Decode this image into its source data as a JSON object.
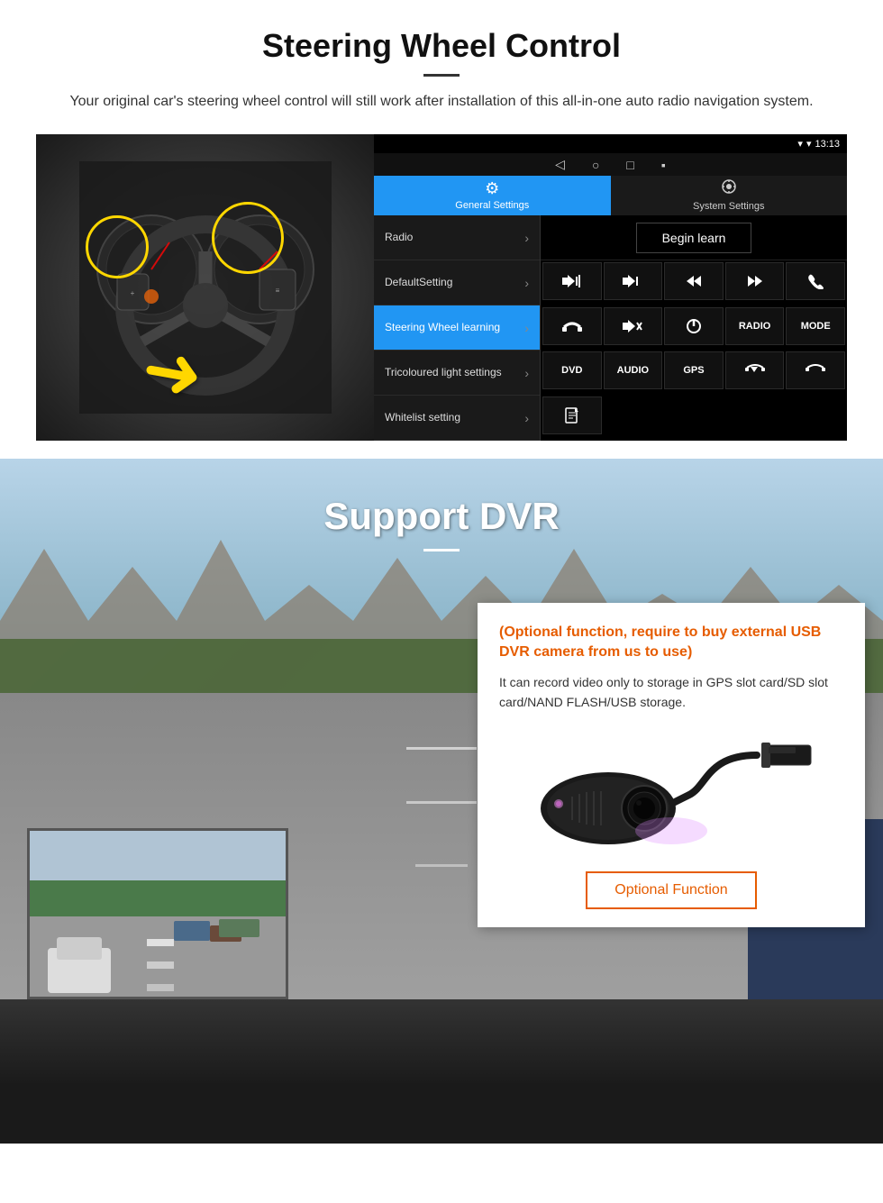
{
  "steering_section": {
    "title": "Steering Wheel Control",
    "description": "Your original car's steering wheel control will still work after installation of this all-in-one auto radio navigation system.",
    "statusbar": {
      "signal": "▾",
      "wifi": "▾",
      "time": "13:13"
    },
    "nav_buttons": [
      "◁",
      "○",
      "□",
      "▪"
    ],
    "tabs": [
      {
        "label": "General Settings",
        "active": true,
        "icon": "⚙"
      },
      {
        "label": "System Settings",
        "active": false,
        "icon": "🔧"
      }
    ],
    "menu_items": [
      {
        "label": "Radio",
        "active": false
      },
      {
        "label": "DefaultSetting",
        "active": false
      },
      {
        "label": "Steering Wheel learning",
        "active": true
      },
      {
        "label": "Tricoloured light settings",
        "active": false
      },
      {
        "label": "Whitelist setting",
        "active": false
      }
    ],
    "begin_learn_label": "Begin learn",
    "control_buttons": [
      {
        "label": "▐+",
        "type": "icon"
      },
      {
        "label": "▐-",
        "type": "icon"
      },
      {
        "label": "⏮",
        "type": "icon"
      },
      {
        "label": "⏭",
        "type": "icon"
      },
      {
        "label": "✆",
        "type": "icon"
      },
      {
        "label": "↩",
        "type": "icon"
      },
      {
        "label": "🔇",
        "type": "icon"
      },
      {
        "label": "⏻",
        "type": "icon"
      },
      {
        "label": "RADIO",
        "type": "text"
      },
      {
        "label": "MODE",
        "type": "text"
      },
      {
        "label": "DVD",
        "type": "text"
      },
      {
        "label": "AUDIO",
        "type": "text"
      },
      {
        "label": "GPS",
        "type": "text"
      },
      {
        "label": "📞⏮",
        "type": "icon"
      },
      {
        "label": "↩⏭",
        "type": "icon"
      },
      {
        "label": "📁",
        "type": "icon"
      }
    ]
  },
  "dvr_section": {
    "title": "Support DVR",
    "optional_title": "(Optional function, require to buy external USB DVR camera from us to use)",
    "description": "It can record video only to storage in GPS slot card/SD slot card/NAND FLASH/USB storage.",
    "optional_function_label": "Optional Function"
  }
}
